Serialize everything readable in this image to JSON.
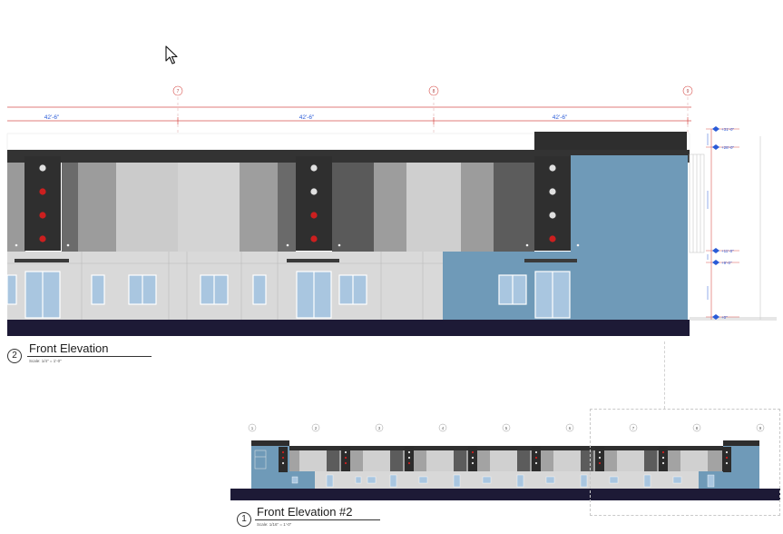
{
  "elevation_main": {
    "grids": [
      "7",
      "8",
      "9"
    ],
    "dimensions": [
      "42'-6\"",
      "42'-6\"",
      "42'-6\""
    ],
    "levels": [
      "+31'-0\"",
      "+28'-0\"",
      "+11'-0\"",
      "+9'-0\"",
      "+0\""
    ],
    "title_number": "2",
    "title": "Front Elevation",
    "scale": "Scale: 1/4\" = 1'-0\""
  },
  "elevation_full": {
    "grids": [
      "1",
      "2",
      "3",
      "4",
      "5",
      "6",
      "7",
      "8",
      "9"
    ],
    "title_number": "1",
    "title": "Front Elevation #2",
    "scale": "Scale: 1/16\" = 1'-0\""
  },
  "colors": {
    "parapet": "#303030",
    "panel_dark": "#4a4a4a",
    "panel_mid": "#9b9b9b",
    "panel_light": "#cdcdcd",
    "wall_light": "#dcdcdc",
    "accent_blue": "#6f9ab8",
    "glass": "#a9c6e0",
    "base": "#1d1a36",
    "light_red": "#cc1f1f",
    "light_white": "#e4e4e4",
    "dimension_red": "#d9534f",
    "dimension_blue": "#2a5bd7"
  }
}
